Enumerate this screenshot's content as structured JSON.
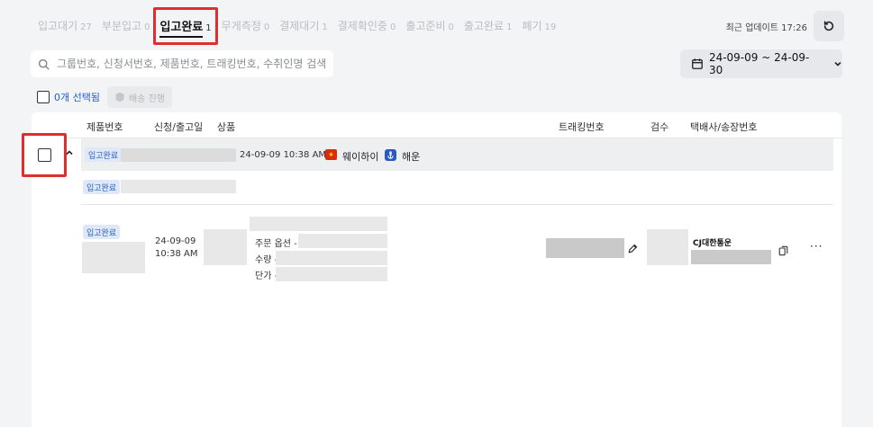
{
  "tabs": [
    {
      "label": "입고대기",
      "count": "27"
    },
    {
      "label": "부분입고",
      "count": "0"
    },
    {
      "label": "입고완료",
      "count": "1",
      "active": true
    },
    {
      "label": "무게측정",
      "count": "0"
    },
    {
      "label": "결제대기",
      "count": "1"
    },
    {
      "label": "결제확인중",
      "count": "0"
    },
    {
      "label": "출고준비",
      "count": "0"
    },
    {
      "label": "출고완료",
      "count": "1"
    },
    {
      "label": "폐기",
      "count": "19"
    }
  ],
  "last_update": "최근 업데이트 17:26",
  "search": {
    "placeholder": "그룹번호, 신청서번호, 제품번호, 트래킹번호, 수취인명 검색"
  },
  "date_range": "24-09-09 ~ 24-09-30",
  "selection": {
    "label": "0개 선택됨",
    "batch_label": "배송 진행"
  },
  "columns": {
    "product_no": "제품번호",
    "request_date": "신청/출고일",
    "product": "상품",
    "tracking": "트래킹번호",
    "inspection": "검수",
    "carrier": "택배사/송장번호"
  },
  "group": {
    "status": "입고완료",
    "datetime": "24-09-09 10:38 AM",
    "origin": "웨이하이",
    "shipping": "해운"
  },
  "sub_status": "입고완료",
  "item": {
    "status": "입고완료",
    "date": "24-09-09",
    "time": "10:38 AM",
    "option_label": "주문 옵션 -",
    "qty_label": "수량 -",
    "price_label": "단가 -",
    "carrier": "CJ대한통운"
  },
  "colors": {
    "highlight": "#e02d2d",
    "accent": "#2460c8"
  }
}
